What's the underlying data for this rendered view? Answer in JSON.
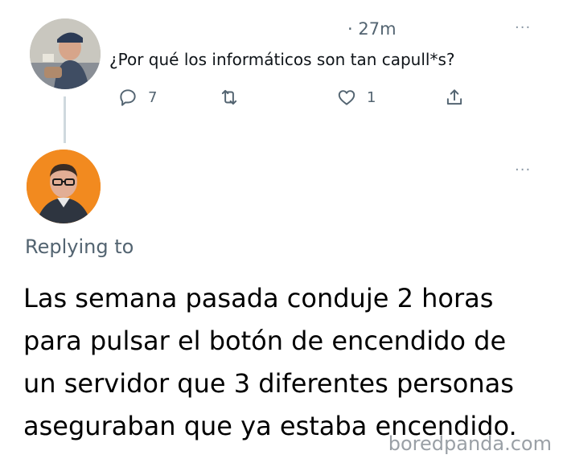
{
  "tweet1": {
    "timestamp": "· 27m",
    "text": "¿Por qué los informáticos son tan capull*s?",
    "more": "···",
    "actions": {
      "reply_count": "7",
      "retweet_count": "",
      "like_count": "1"
    }
  },
  "tweet2": {
    "more": "···",
    "replying_to": "Replying to",
    "text_lines": [
      "Las semana pasada conduje 2 horas",
      "para pulsar el botón de encendido de",
      "un servidor que 3 diferentes personas",
      "aseguraban que ya estaba encendido."
    ]
  },
  "watermark": "boredpanda.com",
  "icons": {
    "reply": "reply-icon",
    "retweet": "retweet-icon",
    "like": "heart-icon",
    "share": "share-icon"
  }
}
